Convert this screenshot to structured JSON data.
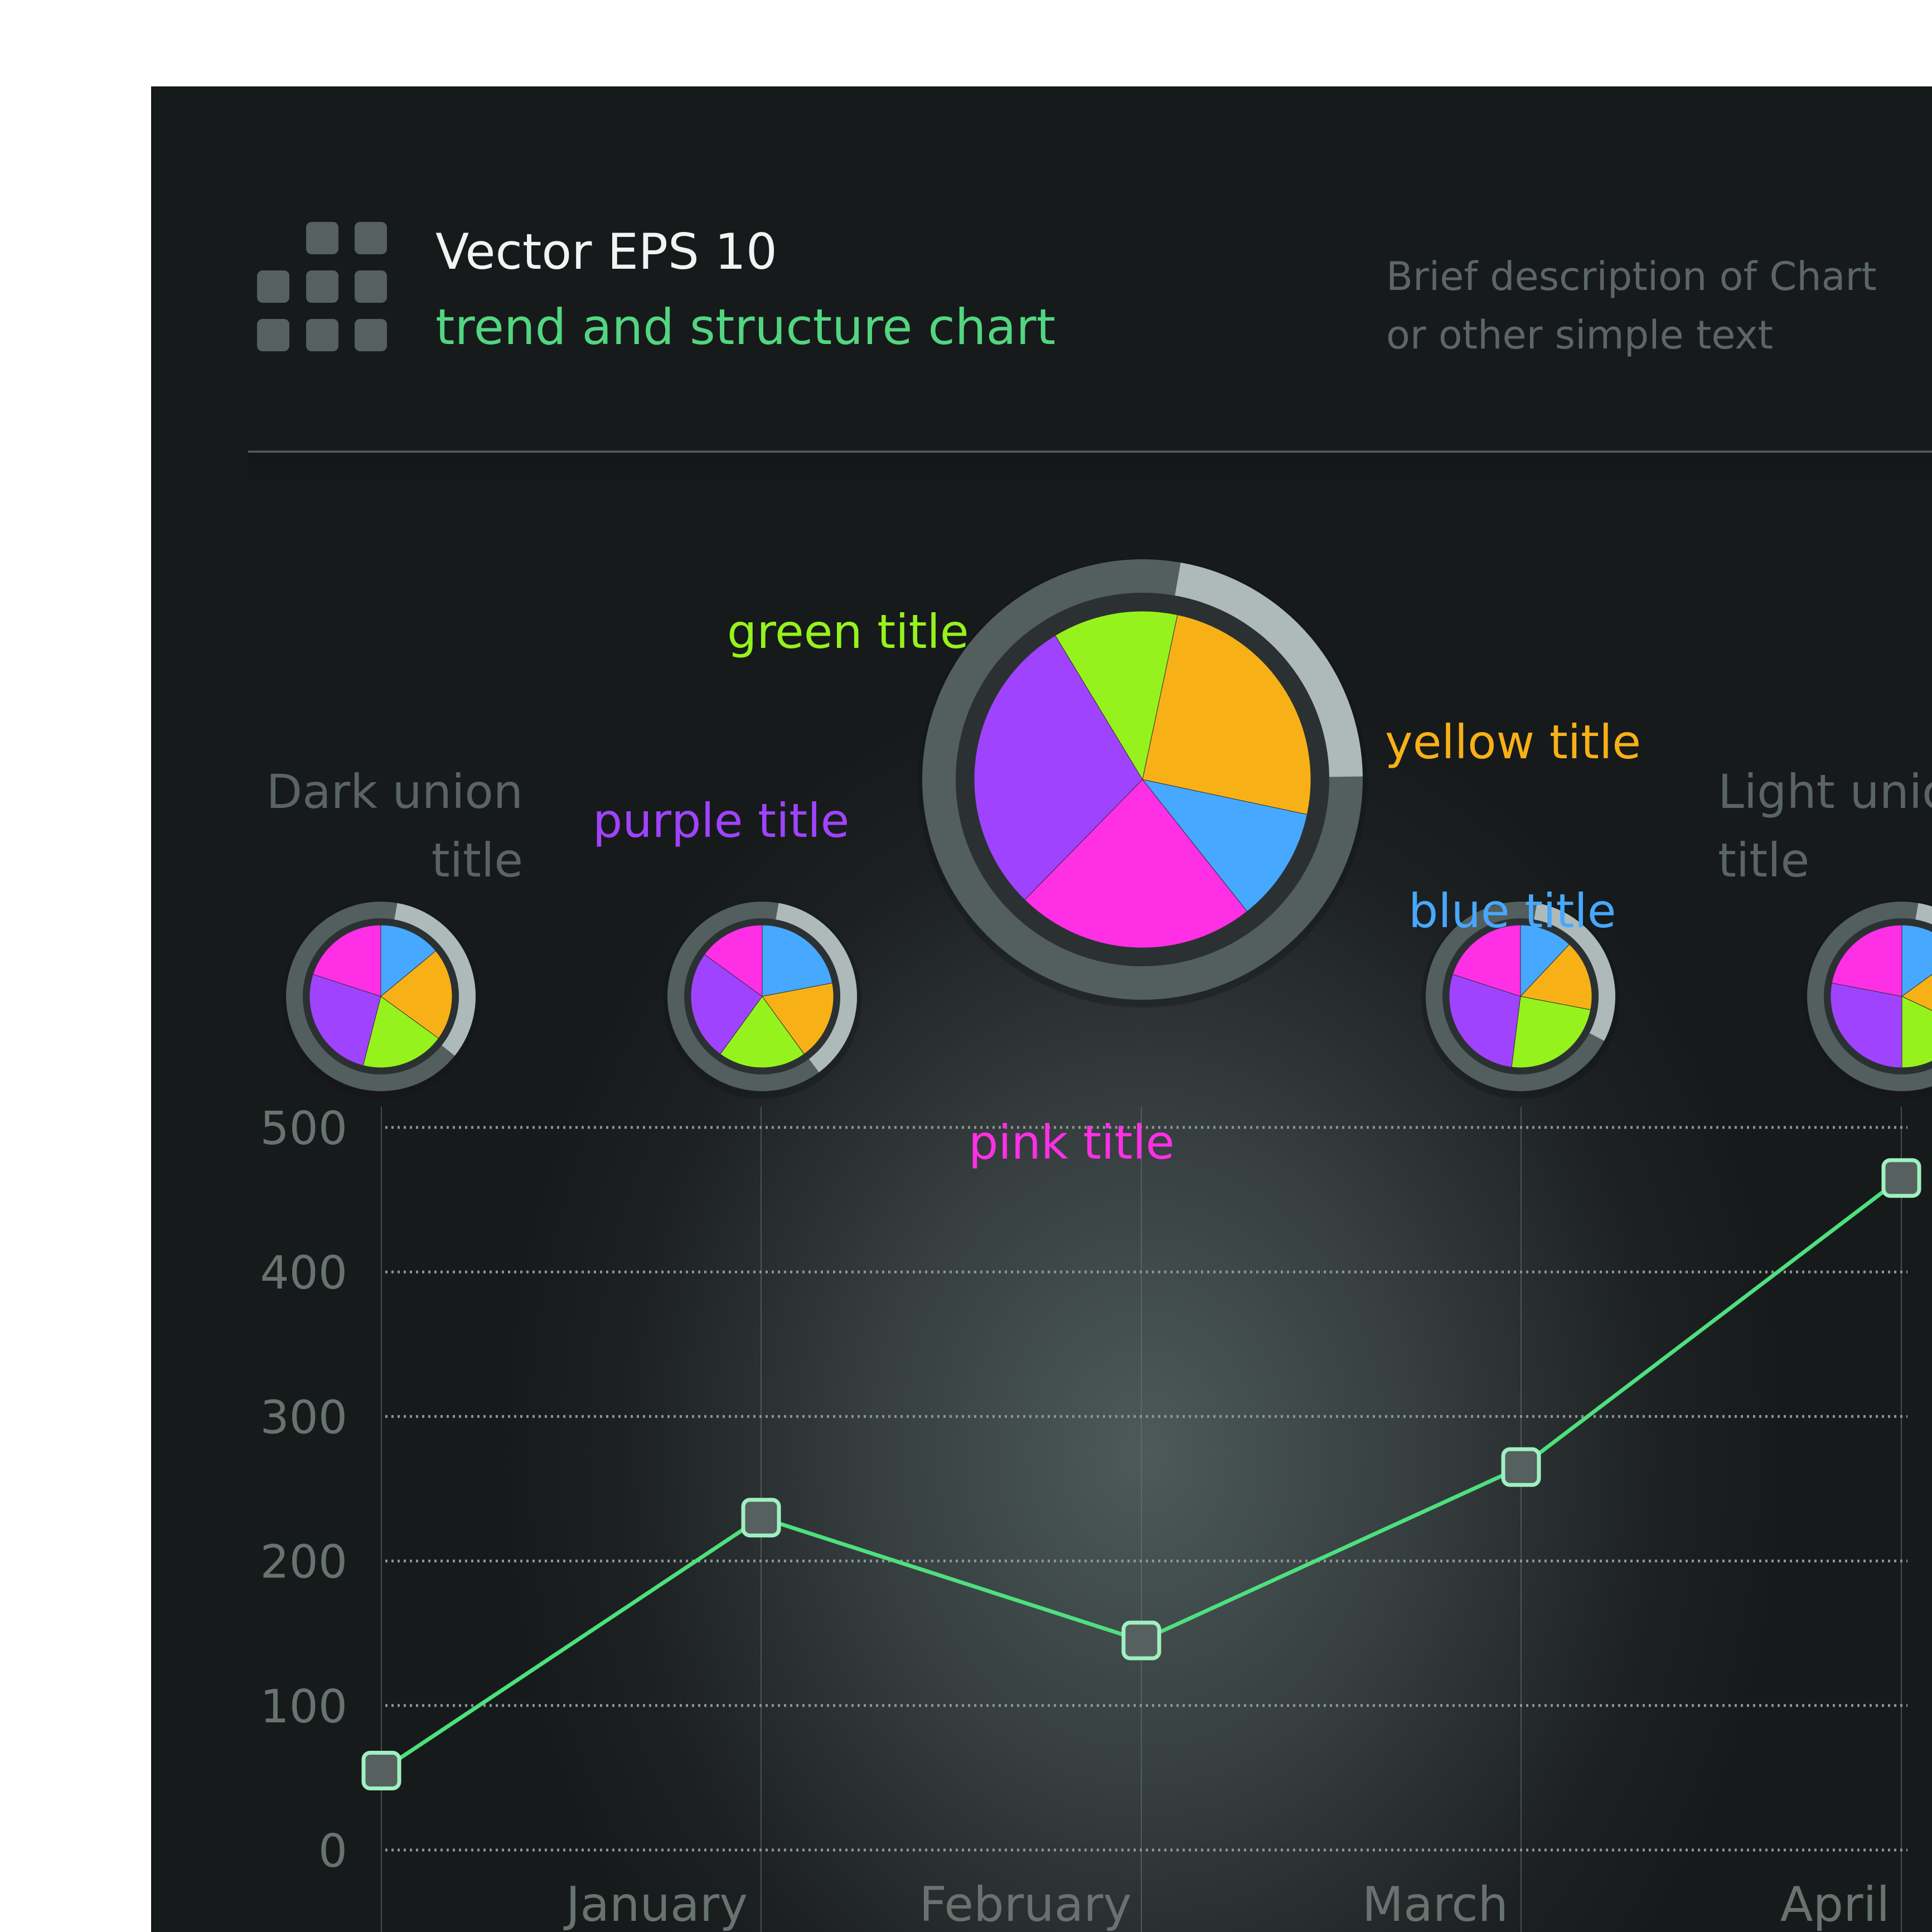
{
  "header": {
    "title": "Vector EPS 10",
    "subtitle": "trend and structure chart",
    "description_line1": "Brief description of Chart",
    "description_line2": "or other simple text"
  },
  "colors": {
    "background": "#1d2122",
    "line": "#4ee07e",
    "marker_fill": "#55605f",
    "marker_border": "#9ff0c0",
    "purple": "#a043ff",
    "green": "#96f21d",
    "yellow": "#f7b117",
    "blue": "#47a8ff",
    "pink": "#ff2fe6",
    "ring_dark": "#535e5e",
    "ring_light": "#aebab9",
    "axis_text": "#68726f",
    "grid": "#8b9594"
  },
  "chart_data": [
    {
      "type": "line",
      "title": "",
      "xlabel": "",
      "ylabel": "",
      "categories": [
        "",
        "January",
        "February",
        "March",
        "April"
      ],
      "x_tick_labels": [
        "January",
        "February",
        "March",
        "April"
      ],
      "values": [
        55,
        230,
        145,
        265,
        465
      ],
      "yticks": [
        0,
        100,
        200,
        300,
        400,
        500
      ],
      "ylim": [
        0,
        500
      ],
      "grid": true,
      "legend": "none"
    },
    {
      "type": "pie",
      "title": "",
      "labels": [
        "yellow title",
        "blue title",
        "pink title",
        "purple title",
        "green title"
      ],
      "values": [
        25,
        11,
        23,
        29,
        12
      ],
      "colors": [
        "#f7b117",
        "#47a8ff",
        "#ff2fe6",
        "#a043ff",
        "#96f21d"
      ],
      "ring_light_fraction": 0.22
    },
    {
      "type": "pie",
      "title": "",
      "labels": [
        "blue",
        "yellow",
        "green",
        "purple",
        "pink"
      ],
      "values": [
        14,
        21,
        19,
        26,
        20
      ],
      "colors": [
        "#47a8ff",
        "#f7b117",
        "#96f21d",
        "#a043ff",
        "#ff2fe6"
      ],
      "ring_light_fraction": 0.33
    },
    {
      "type": "pie",
      "title": "",
      "labels": [
        "blue",
        "yellow",
        "green",
        "purple",
        "pink"
      ],
      "values": [
        22,
        18,
        20,
        25,
        15
      ],
      "colors": [
        "#47a8ff",
        "#f7b117",
        "#96f21d",
        "#a043ff",
        "#ff2fe6"
      ],
      "ring_light_fraction": 0.37
    },
    {
      "type": "pie",
      "title": "",
      "labels": [
        "blue",
        "yellow",
        "green",
        "purple",
        "pink"
      ],
      "values": [
        12,
        16,
        24,
        28,
        20
      ],
      "colors": [
        "#47a8ff",
        "#f7b117",
        "#96f21d",
        "#a043ff",
        "#ff2fe6"
      ],
      "ring_light_fraction": 0.3
    },
    {
      "type": "pie",
      "title": "",
      "labels": [
        "blue",
        "yellow",
        "green",
        "purple",
        "pink"
      ],
      "values": [
        15,
        17,
        18,
        28,
        22
      ],
      "colors": [
        "#47a8ff",
        "#f7b117",
        "#96f21d",
        "#a043ff",
        "#ff2fe6"
      ],
      "ring_light_fraction": 0.25
    }
  ],
  "labels": {
    "green_title": "green title",
    "yellow_title": "yellow title",
    "purple_title": "purple title",
    "blue_title": "blue title",
    "pink_title": "pink title",
    "dark_union_line1": "Dark union",
    "dark_union_line2": "title",
    "light_union_line1": "Light union",
    "light_union_line2": "title"
  }
}
